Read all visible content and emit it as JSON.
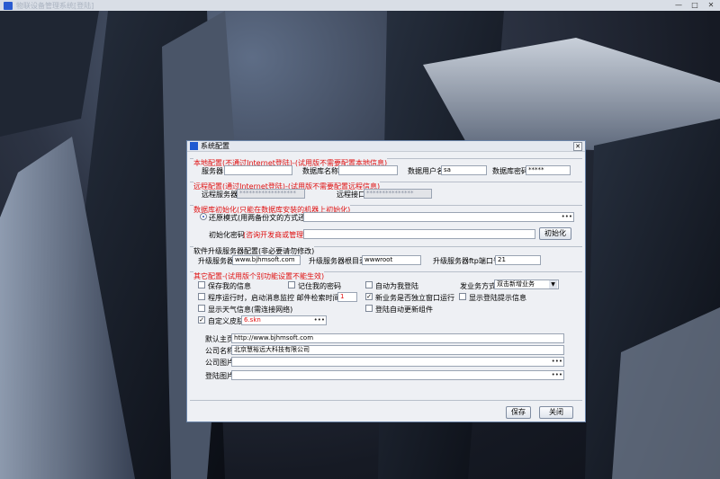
{
  "app": {
    "title": "物联设备管理系统[登陆]",
    "min": "—",
    "max": "□",
    "close": "✕"
  },
  "dialog": {
    "title": "系统配置",
    "close": "✕",
    "local": {
      "section_title": "本地配置(不通过Internet登陆)-(试用版不需要配置本地信息)",
      "server_label": "服务器",
      "server_value": "",
      "dbname_label": "数据库名称",
      "dbname_value": "",
      "dbuser_label": "数据用户名",
      "dbuser_value": "sa",
      "dbpwd_label": "数据库密码",
      "dbpwd_value": "*****"
    },
    "remote": {
      "section_title": "远程配置(通过Internet登陆)-(试用版不需要配置远程信息)",
      "server_label": "远程服务器",
      "server_value": "******************",
      "port_label": "远程接口",
      "port_value": "***************"
    },
    "dbinit": {
      "section_title": "数据库初始化(只能在数据库安装的机器上初始化)",
      "restore_label": "还原模式(用两备份文的方式还原)",
      "path_value": "",
      "pwd_label_prefix": "初始化密码",
      "pwd_label_suffix": "(咨询开发商或管理员)",
      "pwd_value": "",
      "init_button": "初始化"
    },
    "upgrade": {
      "section_title": "软件升级服务器配置(非必要请勿修改)",
      "server_label": "升级服务器",
      "server_value": "www.bjhmsoft.com",
      "root_label": "升级服务器根目录",
      "root_value": "wwwroot",
      "port_label": "升级服务器ftp端口号",
      "port_value": "21"
    },
    "other": {
      "section_title": "其它配置-(试用版个别功能设置不能生效)",
      "save_my_info": "保存我的信息",
      "remember_pwd": "记住我的密码",
      "auto_login": "自动为我登陆",
      "send_mode_label": "发业务方式",
      "send_mode_value": "双击新增业务",
      "monitor_label": "程序运行时，启动消息监控 邮件检索时间(分)",
      "monitor_value": "1",
      "new_biz_window": "新业务是否独立窗口运行",
      "show_login_tip": "显示登陆提示信息",
      "show_weather": "显示天气信息(需连接网络)",
      "auto_update": "登陆自动更新组件",
      "custom_skin": "自定义皮肤",
      "skin_value": "6.skn",
      "homepage_label": "默认主页",
      "homepage_value": "http://www.bjhmsoft.com",
      "company_label": "公司名称",
      "company_value": "北京慧裕远大科技有限公司",
      "company_img_label": "公司图片",
      "company_img_value": "",
      "login_img_label": "登陆图片",
      "login_img_value": ""
    },
    "buttons": {
      "save": "保存",
      "close": "关闭"
    },
    "dots": "•••",
    "check": "✓",
    "arrow": "▼"
  },
  "colors": {
    "section_red": "#e01010",
    "accent": "#1f5ad1"
  }
}
